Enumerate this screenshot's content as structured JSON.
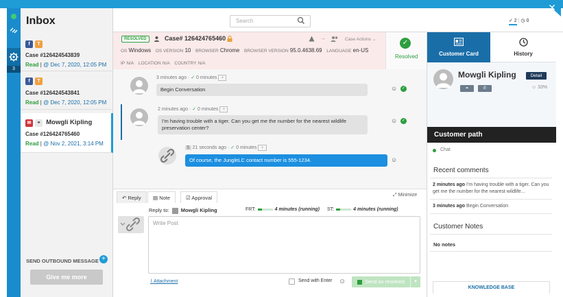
{
  "app": {
    "title": "Inbox",
    "close_glyph": "✕"
  },
  "header": {
    "search_placeholder": "Search",
    "stat_resolved": "✓ 2",
    "stat_pending": "◷ 0"
  },
  "rail": {
    "badge": "3"
  },
  "inbox": {
    "cases": [
      {
        "tags": [
          "f",
          "T"
        ],
        "name": "",
        "case": "Case #126424543839",
        "status": "Read",
        "date": "@ Dec 7, 2020, 12:05 PM"
      },
      {
        "tags": [
          "f",
          "T"
        ],
        "name": "",
        "case": "Case #126424543841",
        "status": "Read",
        "date": "@ Dec 7, 2020, 12:05 PM"
      },
      {
        "tags": [
          "✉",
          "⚭"
        ],
        "name": "Mowgli Kipling",
        "case": "Case #126424765460",
        "status": "Read",
        "date": "@ Nov 2, 2021, 3:14 PM"
      }
    ],
    "send_outbound": "SEND OUTBOUND MESSAGE",
    "give_more": "Give me more"
  },
  "case_info": {
    "badge": "RESOLVED",
    "case_number": "Case# 126424765460",
    "actions": "Case Actions",
    "meta": [
      {
        "label": "OS",
        "value": "Windows"
      },
      {
        "label": "OS VERSION",
        "value": "10"
      },
      {
        "label": "BROWSER",
        "value": "Chrome"
      },
      {
        "label": "BROWSER VERSION",
        "value": "95.0.4638.69"
      },
      {
        "label": "LANGUAGE",
        "value": "en-US"
      },
      {
        "label": "IP",
        "value": "N/A"
      },
      {
        "label": "LOCATION",
        "value": "N/A"
      },
      {
        "label": "COUNTRY",
        "value": "N/A"
      }
    ],
    "resolved_label": "Resolved"
  },
  "messages": [
    {
      "time": "3 minutes ago",
      "read": "0 minutes",
      "text": "Begin Conversation"
    },
    {
      "time": "2 minutes ago",
      "read": "0 minutes",
      "text": "I'm having trouble with a tiger. Can you get me the number for the nearest wildlife preservation center?"
    },
    {
      "time": "21 seconds ago",
      "read": "0 minutes",
      "sender_initial": "S",
      "text": "Of course, the JungleLC contact number is 555-1234."
    }
  ],
  "composer": {
    "tabs": [
      "Reply",
      "Note",
      "Approval"
    ],
    "minimize": "Minimize",
    "reply_to_label": "Reply to:",
    "reply_to_name": "Mowgli Kipling",
    "frt_label": "FRT:",
    "frt_value": "4 minutes (running)",
    "st_label": "ST:",
    "st_value": "4 minutes (running)",
    "placeholder": "Write Post",
    "attachment": "Attachment",
    "send_with_enter": "Send with Enter",
    "send_button": "Send as resolved"
  },
  "right_panel": {
    "tab_card": "Customer Card",
    "tab_history": "History",
    "customer_name": "Mowgli Kipling",
    "detail": "Detail",
    "score": "33%",
    "path_title": "Customer path",
    "path_items": [
      "Chat"
    ],
    "comments_title": "Recent comments",
    "comments": [
      {
        "time": "2 minutes ago",
        "text": "I'm having trouble with a tiger. Can you get me the number for the nearest wildlife..."
      },
      {
        "time": "3 minutes ago",
        "text": "Begin Conversation"
      }
    ],
    "notes_title": "Customer Notes",
    "notes_empty": "No notes",
    "kb_button": "KNOWLEDGE BASE"
  },
  "colors": {
    "accent": "#1f9bd6",
    "dark_blue": "#1a6ea8",
    "success": "#2e9e3e",
    "case_bg": "#fbeaea"
  }
}
